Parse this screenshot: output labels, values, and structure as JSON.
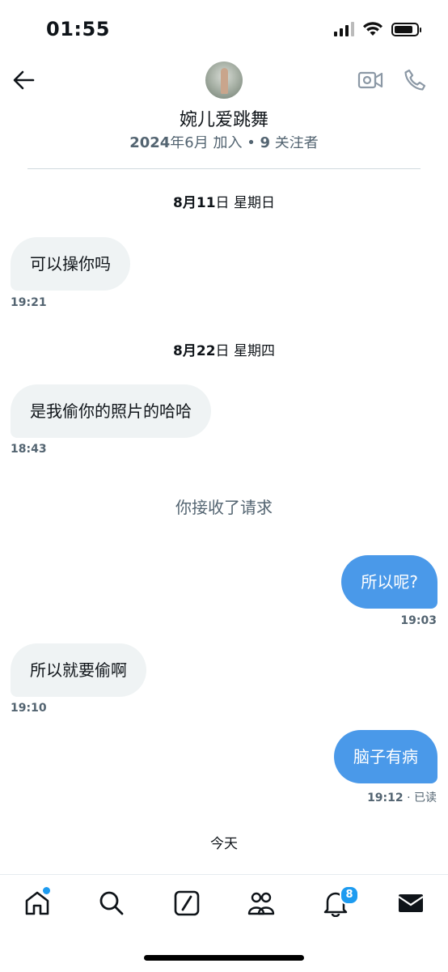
{
  "status_bar": {
    "time": "01:55"
  },
  "header": {
    "title": "婉儿爱跳舞"
  },
  "profile_meta": {
    "joined_year": "2024",
    "joined_rest": "年6月 加入 • ",
    "following_count": "9",
    "following_label": " 关注者"
  },
  "dates": [
    {
      "prefix": "8月",
      "day": "11",
      "suffix": "日 星期日"
    },
    {
      "prefix": "8月",
      "day": "22",
      "suffix": "日 星期四"
    }
  ],
  "messages": [
    {
      "direction": "in",
      "text": "可以操你吗",
      "time": "19:21"
    },
    {
      "direction": "in",
      "text": "是我偷你的照片的哈哈",
      "time": "18:43"
    },
    {
      "direction": "out",
      "text": "所以呢?",
      "time": "19:03"
    },
    {
      "direction": "in",
      "text": "所以就要偷啊",
      "time": "19:10"
    },
    {
      "direction": "out",
      "text": "脑子有病",
      "time": "19:12",
      "status": " · 已读"
    }
  ],
  "system_message": "你接收了请求",
  "today_label": "今天",
  "nav": {
    "notifications_badge": "8"
  },
  "colors": {
    "accent": "#1d9bf0",
    "outgoing_bubble": "#4a99e9",
    "incoming_bubble": "#eff3f4",
    "muted_text": "#536471"
  },
  "icons": [
    "back-arrow-icon",
    "video-call-icon",
    "phone-icon",
    "home-icon",
    "search-icon",
    "compose-icon",
    "communities-icon",
    "bell-icon",
    "mail-icon"
  ]
}
